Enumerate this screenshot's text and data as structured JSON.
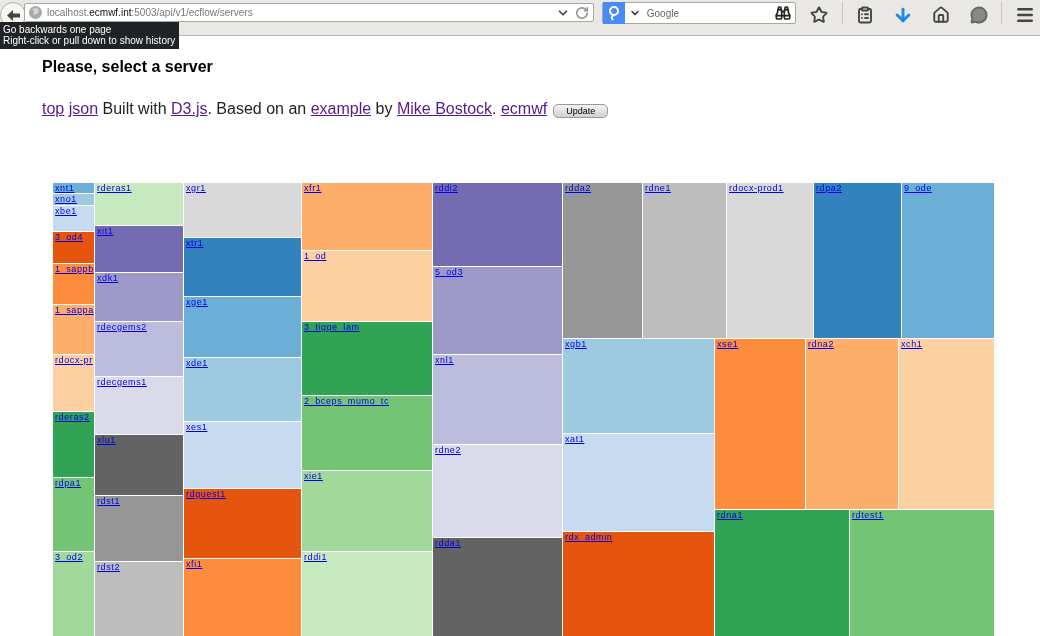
{
  "browser": {
    "url": "localhost.**ecmwf.int**:5003/api/v1/ecflow/servers",
    "search_placeholder": "Google"
  },
  "tooltip": {
    "lines": [
      "Go backwards one page",
      "Right-click or pull down to show history"
    ]
  },
  "heading": "Please, select a server",
  "credits": [
    {
      "kind": "link",
      "text": "top"
    },
    {
      "kind": "link",
      "text": "json"
    },
    {
      "kind": "text",
      "text": " Built with "
    },
    {
      "kind": "link",
      "text": "D3.js"
    },
    {
      "kind": "text",
      "text": ". Based on an "
    },
    {
      "kind": "link",
      "text": "example"
    },
    {
      "kind": "text",
      "text": " by "
    },
    {
      "kind": "link",
      "text": "Mike Bostock"
    },
    {
      "kind": "text",
      "text": ". "
    },
    {
      "kind": "link",
      "text": "ecmwf"
    }
  ],
  "update_button": "Update",
  "treemap": {
    "tiles": [
      {
        "label": "xnt1",
        "color": "#6baed6"
      },
      {
        "label": "xno1",
        "color": "#9ecae1"
      },
      {
        "label": "xbe1",
        "color": "#c6dbef"
      },
      {
        "label": "3_od4",
        "color": "#e6550d"
      },
      {
        "label": "1_sappb",
        "color": "#fd8d3c"
      },
      {
        "label": "1_sappa",
        "color": "#fdae6b"
      },
      {
        "label": "rdocx-pr",
        "color": "#fdd0a2"
      },
      {
        "label": "rderas2",
        "color": "#31a354"
      },
      {
        "label": "rdpa1",
        "color": "#74c476"
      },
      {
        "label": "3_od2",
        "color": "#a1d99b"
      },
      {
        "label": "rderas1",
        "color": "#c7e9c0"
      },
      {
        "label": "xit1",
        "color": "#756bb1"
      },
      {
        "label": "xdk1",
        "color": "#9e9ac8"
      },
      {
        "label": "rdecgems2",
        "color": "#bcbddc"
      },
      {
        "label": "rdecgems1",
        "color": "#dadaeb"
      },
      {
        "label": "xlu1",
        "color": "#636363"
      },
      {
        "label": "rdst1",
        "color": "#969696"
      },
      {
        "label": "rdst2",
        "color": "#bdbdbd"
      },
      {
        "label": "xgr1",
        "color": "#d9d9d9"
      },
      {
        "label": "xtr1",
        "color": "#3182bd"
      },
      {
        "label": "xge1",
        "color": "#6baed6"
      },
      {
        "label": "xde1",
        "color": "#9ecae1"
      },
      {
        "label": "xes1",
        "color": "#c6dbef"
      },
      {
        "label": "rdguest1",
        "color": "#e6550d"
      },
      {
        "label": "xfi1",
        "color": "#fd8d3c"
      },
      {
        "label": "xfr1",
        "color": "#fdae6b"
      },
      {
        "label": "1_od",
        "color": "#fdd0a2"
      },
      {
        "label": "3_tigge_lam",
        "color": "#31a354"
      },
      {
        "label": "2_bceps_mumo_tc",
        "color": "#74c476"
      },
      {
        "label": "xie1",
        "color": "#a1d99b"
      },
      {
        "label": "rddi1",
        "color": "#c7e9c0"
      },
      {
        "label": "rddi2",
        "color": "#756bb1"
      },
      {
        "label": "5_od3",
        "color": "#9e9ac8"
      },
      {
        "label": "xnl1",
        "color": "#bcbddc"
      },
      {
        "label": "rdne2",
        "color": "#dadaeb"
      },
      {
        "label": "rdda1",
        "color": "#636363"
      },
      {
        "label": "rdda2",
        "color": "#969696"
      },
      {
        "label": "rdne1",
        "color": "#bdbdbd"
      },
      {
        "label": "rdocx-prod1",
        "color": "#d9d9d9"
      },
      {
        "label": "rdpa2",
        "color": "#3182bd"
      },
      {
        "label": "9_ode",
        "color": "#6baed6"
      },
      {
        "label": "xgb1",
        "color": "#9ecae1"
      },
      {
        "label": "xat1",
        "color": "#c6dbef"
      },
      {
        "label": "rdx_admin",
        "color": "#e6550d"
      },
      {
        "label": "xse1",
        "color": "#fd8d3c"
      },
      {
        "label": "rdna2",
        "color": "#fdae6b"
      },
      {
        "label": "xch1",
        "color": "#fdd0a2"
      },
      {
        "label": "rdna1",
        "color": "#31a354"
      },
      {
        "label": "rdtest1",
        "color": "#74c476"
      }
    ]
  }
}
